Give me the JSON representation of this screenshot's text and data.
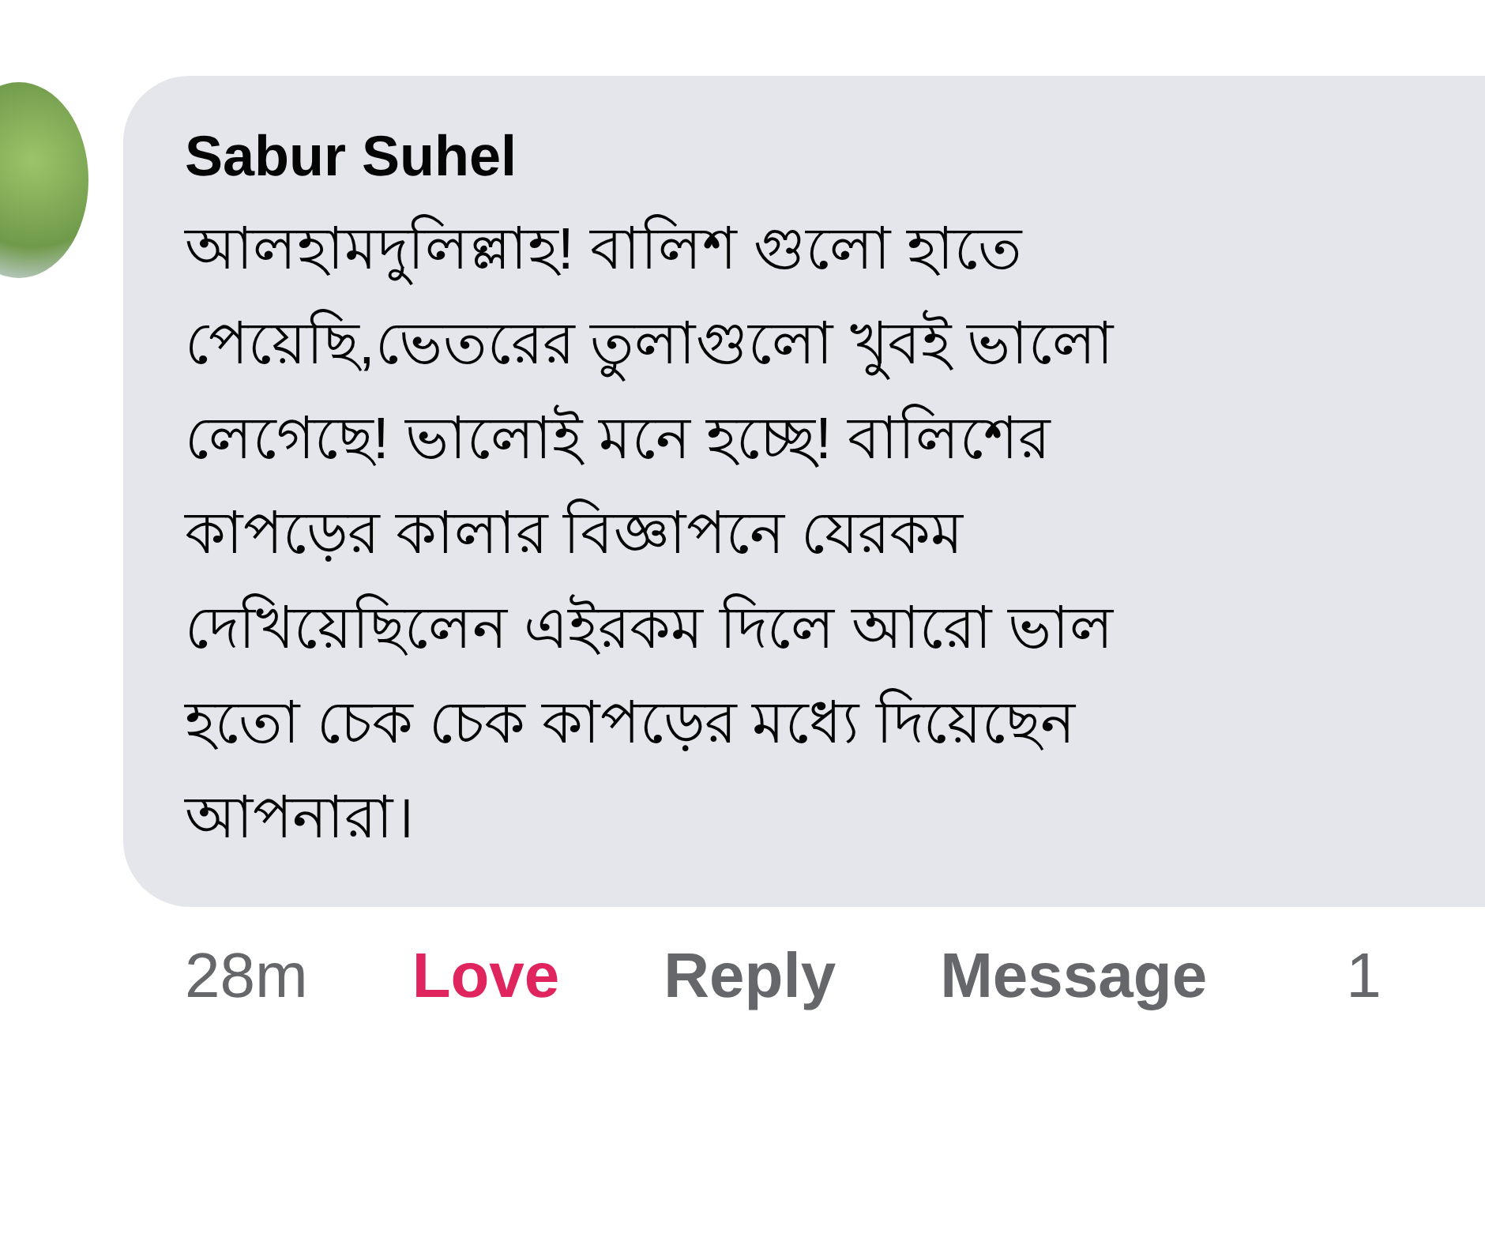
{
  "comment": {
    "author": "Sabur Suhel",
    "lines": [
      "আলহামদুলিল্লাহ! বালিশ গুলো হাতে",
      "পেয়েছি,ভেতরের তুলাগুলো খুবই ভালো",
      "লেগেছে!  ভালোই মনে হচ্ছে!  বালিশের",
      "কাপড়ের কালার বিজ্ঞাপনে যেরকম",
      "দেখিয়েছিলেন এইরকম দিলে আরো ভাল",
      "হতো চেক চেক কাপড়ের মধ্যে দিয়েছেন",
      "আপনারা।"
    ]
  },
  "footer": {
    "time": "28m",
    "actions": [
      {
        "label": "Love",
        "active": true
      },
      {
        "label": "Reply",
        "active": false
      },
      {
        "label": "Message",
        "active": false
      }
    ],
    "count": "1"
  }
}
